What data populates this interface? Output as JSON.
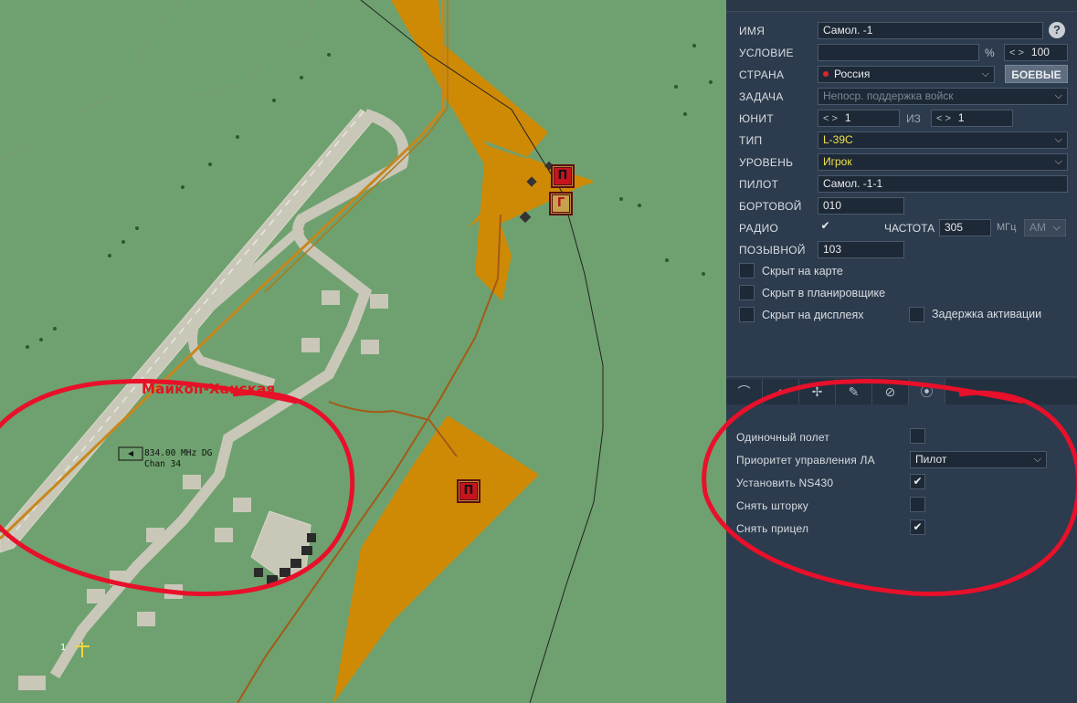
{
  "map": {
    "airfield_name": "Майкоп-Ханская",
    "beacon_freq": "834.00 MHz DG",
    "beacon_chan": "Chan 34",
    "waypoint_number": "1",
    "unit_markers": [
      "П",
      "Г",
      "П"
    ],
    "colors": {
      "terrain": "#6ea16f",
      "zone": "#cf8a05",
      "route": "#111111",
      "annotation": "#e8102a"
    }
  },
  "form": {
    "name_label": "ИМЯ",
    "name_value": "Самол. -1",
    "help_glyph": "?",
    "condition_label": "УСЛОВИЕ",
    "condition_value": "",
    "percent_sign": "%",
    "condition_pct": "100",
    "country_label": "СТРАНА",
    "country_value": "Россия",
    "combat_button": "БОЕВЫЕ",
    "task_label": "ЗАДАЧА",
    "task_value": "Непоср. поддержка войск",
    "unit_label": "ЮНИТ",
    "unit_value": "1",
    "of_label": "ИЗ",
    "of_value": "1",
    "type_label": "ТИП",
    "type_value": "L-39C",
    "skill_label": "УРОВЕНЬ",
    "skill_value": "Игрок",
    "pilot_label": "ПИЛОТ",
    "pilot_value": "Самол. -1-1",
    "board_label": "БОРТОВОЙ",
    "board_value": "010",
    "radio_label": "РАДИО",
    "radio_checked": true,
    "freq_label": "ЧАСТОТА",
    "freq_value": "305",
    "freq_unit": "МГц",
    "modulation": "AM",
    "callsign_label": "ПОЗЫВНОЙ",
    "callsign_value": "103",
    "hidden_map": "Скрыт на карте",
    "hidden_planner": "Скрыт в планировщике",
    "hidden_displays": "Скрыт на дисплеях",
    "late_activation": "Задержка активации"
  },
  "tabs": [
    {
      "icon": "route-icon"
    },
    {
      "icon": "target-icon"
    },
    {
      "icon": "loadout-icon"
    },
    {
      "icon": "pencil-icon"
    },
    {
      "icon": "block-icon"
    },
    {
      "icon": "radio-signal-icon"
    }
  ],
  "options": {
    "single_flight": "Одиночный полет",
    "single_flight_checked": false,
    "control_priority": "Приоритет управления ЛА",
    "control_priority_value": "Пилот",
    "install_ns430": "Установить NS430",
    "install_ns430_checked": true,
    "remove_curtain": "Снять шторку",
    "remove_curtain_checked": false,
    "remove_sight": "Снять прицел",
    "remove_sight_checked": true
  }
}
